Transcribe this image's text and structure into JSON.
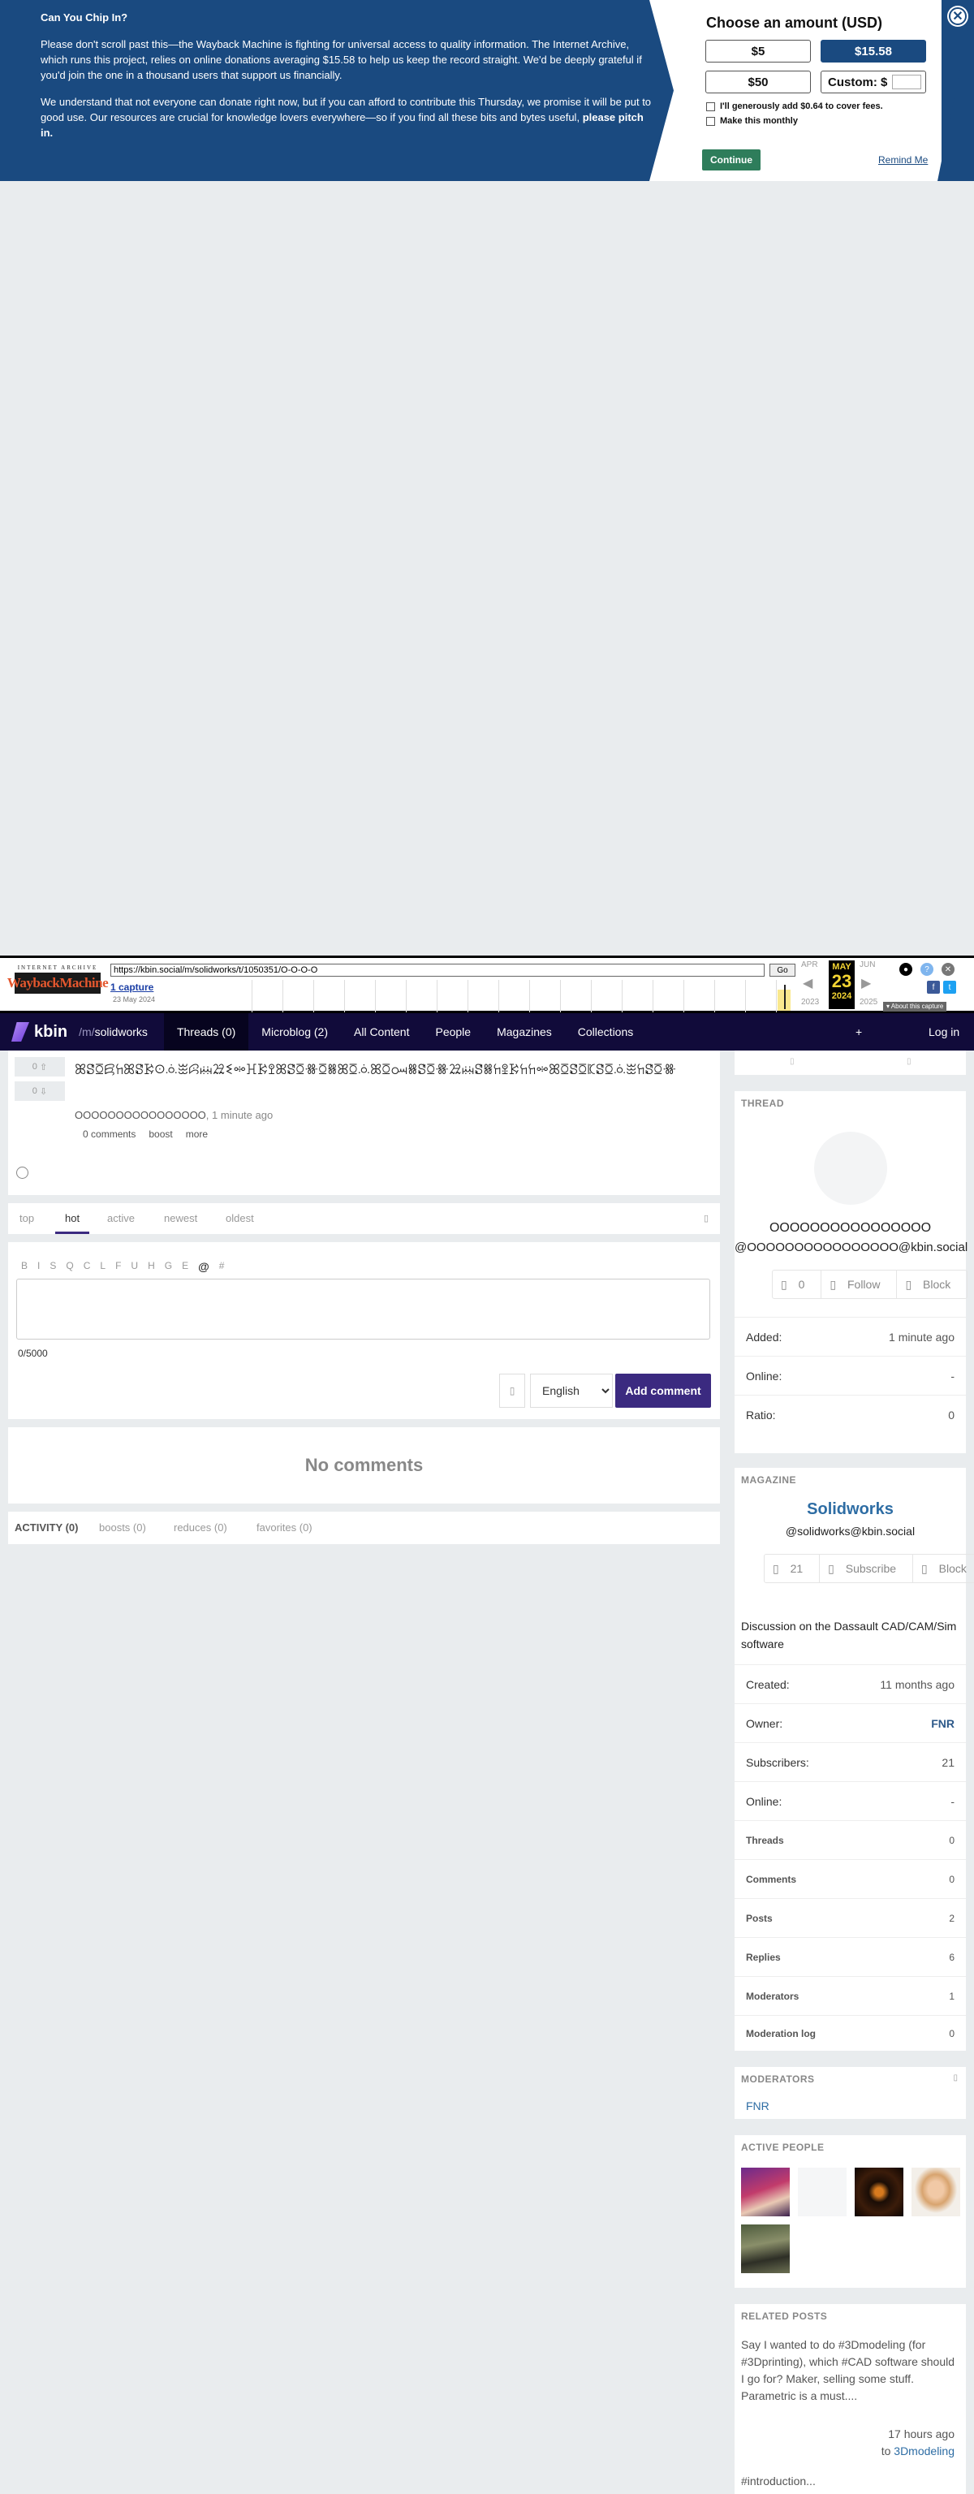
{
  "donation": {
    "title": "Can You Chip In?",
    "para1": "Please don't scroll past this—the Wayback Machine is fighting for universal access to quality information. The Internet Archive, which runs this project, relies on online donations averaging $15.58 to help us keep the record straight. We'd be deeply grateful if you'd join the one in a thousand users that support us financially.",
    "para2": "We understand that not everyone can donate right now, but if you can afford to contribute this Thursday, we promise it will be put to good use. Our resources are crucial for knowledge lovers everywhere—so if you find all these bits and bytes useful,",
    "para2_bold": "please pitch in.",
    "choose_label": "Choose an amount (USD)",
    "amounts": [
      "$5",
      "$15.58",
      "$50",
      "Custom: $"
    ],
    "selected_amount": "$15.58",
    "cover_fees": "I'll generously add $0.64 to cover fees.",
    "monthly": "Make this monthly",
    "continue": "Continue",
    "remind": "Remind Me",
    "close": "✕",
    "colors": {
      "banner": "#1a4a80",
      "continue": "#2e7d5b"
    }
  },
  "wayback": {
    "logo_top": "INTERNET ARCHIVE",
    "logo_main": "WaybackMachine",
    "url": "https://kbin.social/m/solidworks/t/1050351/O-O-O-O",
    "go": "Go",
    "captures": "1 capture",
    "capture_date": "23 May 2024",
    "prev_month": "APR",
    "cur_month": "MAY",
    "next_month": "JUN",
    "day": "23",
    "prev_year": "2023",
    "cur_year": "2024",
    "next_year": "2025",
    "about": "▾ About this capture"
  },
  "nav": {
    "brand": "kbin",
    "mag_prefix": "/m/",
    "mag_name": "solidworks",
    "tabs": [
      "Threads (0)",
      "Microblog (2)",
      "All Content",
      "People",
      "Magazines",
      "Collections"
    ],
    "active_tab": "Threads (0)",
    "search_icon": "",
    "add_icon": "+",
    "menu_icon": "",
    "login": "Log in"
  },
  "entry": {
    "up": "0",
    "down": "0",
    "title": "ꕤꗟꗞꗛꖷꕤꗟꗣꖴꗝꖿꕸꗜꗠꗨꗮꖾꗣꖶꕤꗟꗞꗥꗞꗤꕤꗞꗝꕤꗞꗢꗤꗟꗞꗥꗠꗜꗟꗤꖷꖵꗣꖷꖷꗮꕤꗞꗟꗞꗫꗟꗞꗝꖿꖷꗟꗞꗥ",
    "author": "OOOOOOOOOOOOOOOO",
    "time": "1 minute ago",
    "comments": "0 comments",
    "boost": "boost",
    "more": "more"
  },
  "sort": {
    "options": [
      "top",
      "hot",
      "active",
      "newest",
      "oldest"
    ],
    "active": "hot"
  },
  "comment_form": {
    "toolbar": [
      "B",
      "I",
      "S",
      "Q",
      "C",
      "L",
      "F",
      "U",
      "H",
      "G",
      "E",
      "@",
      "#"
    ],
    "counter": "0/5000",
    "language": "English",
    "submit": "Add comment"
  },
  "no_comments": "No comments",
  "activity": {
    "label": "ACTIVITY (0)",
    "boosts": "boosts (0)",
    "reduces": "reduces (0)",
    "favorites": "favorites (0)"
  },
  "thread_panel": {
    "heading": "THREAD",
    "username": "OOOOOOOOOOOOOOOO",
    "handle": "@OOOOOOOOOOOOOOOO@kbin.social",
    "followers": "0",
    "follow": "Follow",
    "block": "Block",
    "stats": [
      {
        "k": "Added:",
        "v": "1 minute ago"
      },
      {
        "k": "Online:",
        "v": "-"
      },
      {
        "k": "Ratio:",
        "v": "0"
      }
    ]
  },
  "magazine_panel": {
    "heading": "MAGAZINE",
    "name": "Solidworks",
    "handle": "@solidworks@kbin.social",
    "subscribers_count": "21",
    "subscribe": "Subscribe",
    "block": "Block",
    "description": "Discussion on the Dassault CAD/CAM/Sim software",
    "stats": [
      {
        "k": "Created:",
        "v": "11 months ago"
      },
      {
        "k": "Owner:",
        "v": "FNR"
      },
      {
        "k": "Subscribers:",
        "v": "21"
      },
      {
        "k": "Online:",
        "v": "-"
      }
    ],
    "counts": [
      {
        "k": "Threads",
        "v": "0"
      },
      {
        "k": "Comments",
        "v": "0"
      },
      {
        "k": "Posts",
        "v": "2"
      },
      {
        "k": "Replies",
        "v": "6"
      },
      {
        "k": "Moderators",
        "v": "1"
      },
      {
        "k": "Moderation log",
        "v": "0"
      }
    ]
  },
  "moderators_panel": {
    "heading": "MODERATORS",
    "mod": "FNR"
  },
  "active_people": {
    "heading": "ACTIVE PEOPLE"
  },
  "related_posts": {
    "heading": "RELATED POSTS",
    "post": "Say I wanted to do #3Dmodeling (for #3Dprinting), which #CAD software should I go for? Maker, selling some stuff. Parametric is a must....",
    "time": "17 hours ago",
    "to": "to",
    "magazine": "3Dmodeling",
    "next": "#introduction..."
  }
}
